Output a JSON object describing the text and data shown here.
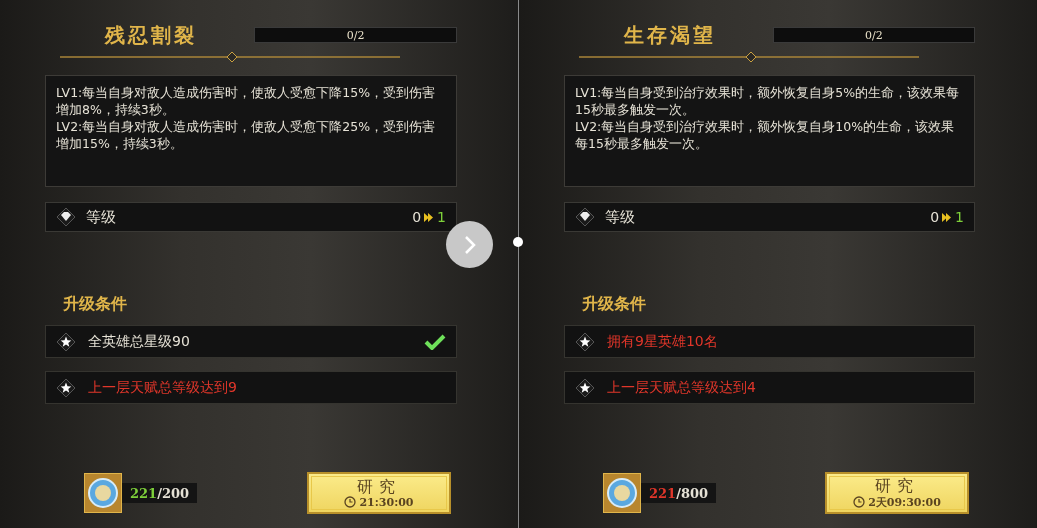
{
  "panels": [
    {
      "title": "残忍割裂",
      "progress": {
        "text": "0/2",
        "level": 0
      },
      "description": [
        "LV1:每当自身对敌人造成伤害时，使敌人受愈下降15%，受到伤害增加8%，持续3秒。",
        "LV2:每当自身对敌人造成伤害时，使敌人受愈下降25%，受到伤害增加15%，持续3秒。"
      ],
      "level": {
        "label": "等级",
        "from": "0",
        "to": "1"
      },
      "conditions_heading": "升级条件",
      "conditions": [
        {
          "text": "全英雄总星级90",
          "met": true
        },
        {
          "text": "上一层天赋总等级达到9",
          "met": false
        }
      ],
      "cost": {
        "have": "221",
        "required": "/200",
        "enough": true
      },
      "research": {
        "label": "研究",
        "time": "21:30:00"
      }
    },
    {
      "title": "生存渴望",
      "progress": {
        "text": "0/2",
        "level": 0
      },
      "description": [
        "LV1:每当自身受到治疗效果时，额外恢复自身5%的生命，该效果每15秒最多触发一次。",
        "LV2:每当自身受到治疗效果时，额外恢复自身10%的生命，该效果每15秒最多触发一次。"
      ],
      "level": {
        "label": "等级",
        "from": "0",
        "to": "1"
      },
      "conditions_heading": "升级条件",
      "conditions": [
        {
          "text": "拥有9星英雄10名",
          "met": false
        },
        {
          "text": "上一层天赋总等级达到4",
          "met": false
        }
      ],
      "cost": {
        "have": "221",
        "required": "/800",
        "enough": false
      },
      "research": {
        "label": "研究",
        "time": "2天09:30:00"
      }
    }
  ]
}
